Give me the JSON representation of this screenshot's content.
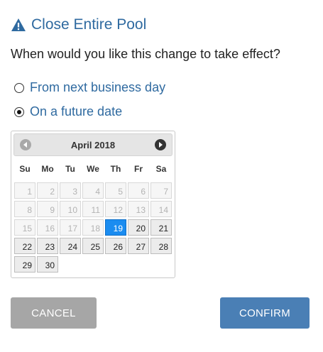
{
  "dialog": {
    "title": "Close Entire Pool",
    "question": "When would you like this change to take effect?"
  },
  "options": [
    {
      "label": "From next business day",
      "checked": false
    },
    {
      "label": "On a future date",
      "checked": true
    }
  ],
  "calendar": {
    "month_label": "April 2018",
    "weekdays": [
      "Su",
      "Mo",
      "Tu",
      "We",
      "Th",
      "Fr",
      "Sa"
    ],
    "first_weekday_offset": 0,
    "days_in_month": 30,
    "selected_day": 19,
    "first_enabled_day": 20
  },
  "buttons": {
    "cancel": "CANCEL",
    "confirm": "CONFIRM"
  },
  "colors": {
    "accent": "#2f6aa0",
    "selected_day": "#1a8cf0",
    "confirm_button": "#4a7fb5",
    "cancel_button": "#a6a6a6"
  },
  "icons": {
    "title": "warning-icon",
    "prev": "chevron-left-icon",
    "next": "chevron-right-icon"
  }
}
